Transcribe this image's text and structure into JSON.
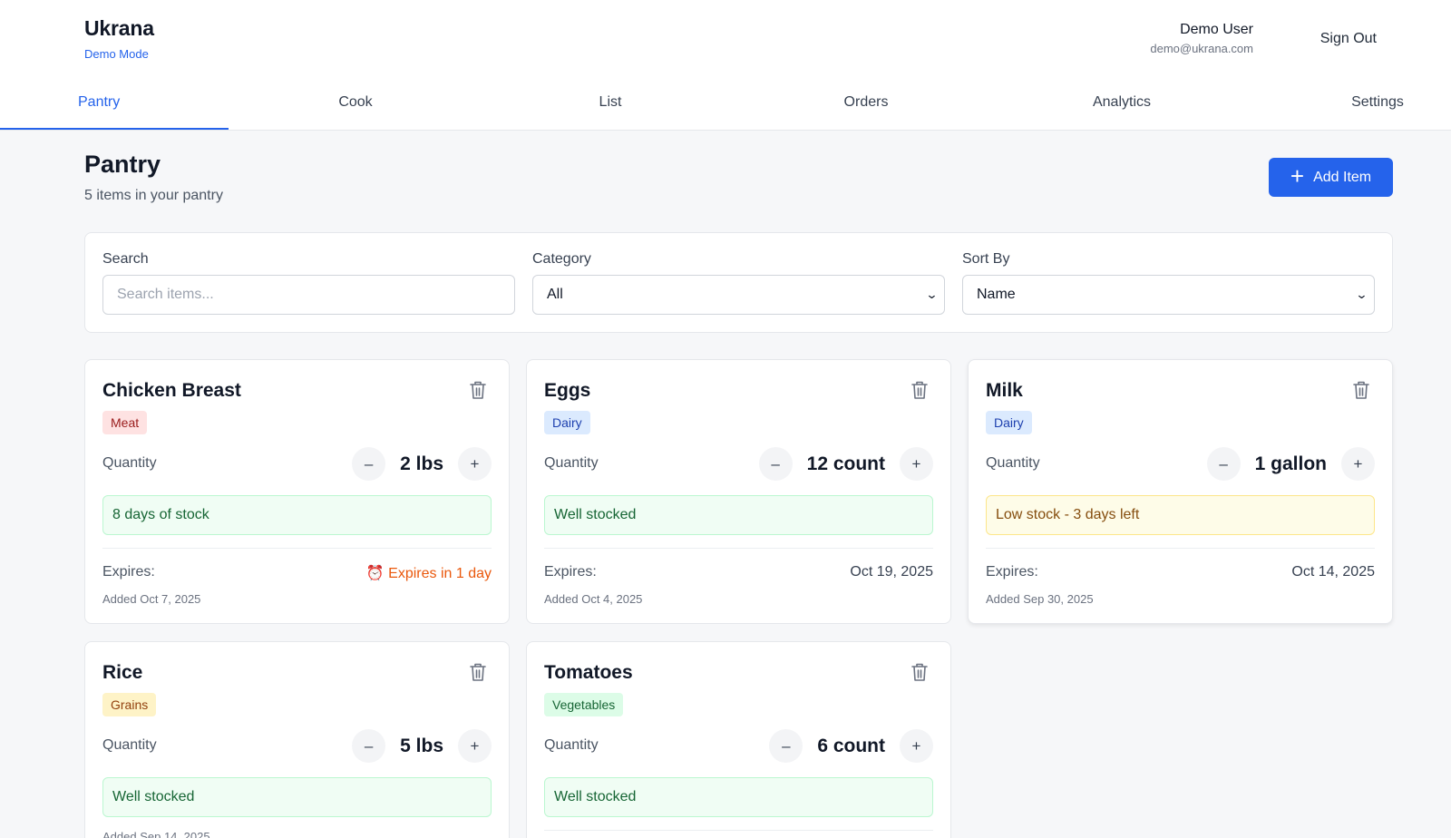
{
  "app": {
    "name": "Ukrana",
    "mode": "Demo Mode"
  },
  "user": {
    "name": "Demo User",
    "email": "demo@ukrana.com",
    "sign_out": "Sign Out"
  },
  "tabs": [
    {
      "label": "Pantry",
      "active": true
    },
    {
      "label": "Cook",
      "active": false
    },
    {
      "label": "List",
      "active": false
    },
    {
      "label": "Orders",
      "active": false
    },
    {
      "label": "Analytics",
      "active": false
    },
    {
      "label": "Settings",
      "active": false
    }
  ],
  "page": {
    "title": "Pantry",
    "subtitle": "5 items in your pantry",
    "add_label": "Add Item"
  },
  "filters": {
    "search_label": "Search",
    "search_placeholder": "Search items...",
    "category_label": "Category",
    "category_value": "All",
    "sort_label": "Sort By",
    "sort_value": "Name"
  },
  "labels": {
    "quantity": "Quantity",
    "expires": "Expires:"
  },
  "colors": {
    "accent": "#2563eb",
    "good": "#166534",
    "low": "#854d0e",
    "warn": "#ea580c"
  },
  "items": [
    {
      "name": "Chicken Breast",
      "category": "Meat",
      "quantity": "2 lbs",
      "stock": "8 days of stock",
      "expires": "⏰ Expires in 1 day",
      "added": "Added Oct 7, 2025"
    },
    {
      "name": "Eggs",
      "category": "Dairy",
      "quantity": "12 count",
      "stock": "Well stocked",
      "expires": "Oct 19, 2025",
      "added": "Added Oct 4, 2025"
    },
    {
      "name": "Milk",
      "category": "Dairy",
      "quantity": "1 gallon",
      "stock": "Low stock - 3 days left",
      "expires": "Oct 14, 2025",
      "added": "Added Sep 30, 2025"
    },
    {
      "name": "Rice",
      "category": "Grains",
      "quantity": "5 lbs",
      "stock": "Well stocked",
      "added": "Added Sep 14, 2025"
    },
    {
      "name": "Tomatoes",
      "category": "Vegetables",
      "quantity": "6 count",
      "stock": "Well stocked"
    }
  ],
  "icons": {
    "trash": "trash-icon",
    "plus": "plus-icon",
    "alarm": "alarm-clock-icon",
    "chevron": "chevron-down-icon"
  }
}
